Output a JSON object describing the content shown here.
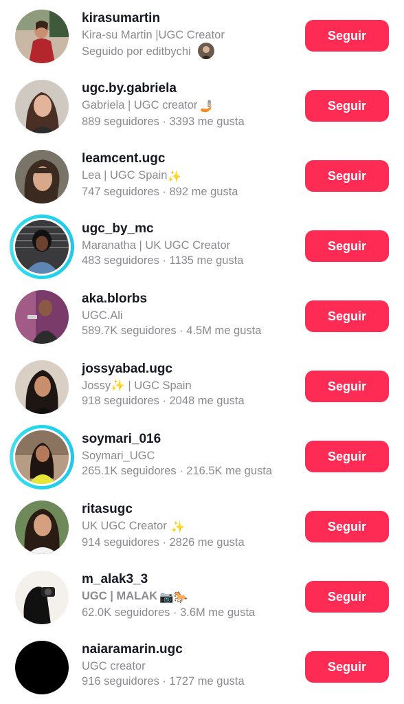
{
  "follow_label": "Seguir",
  "accent_color": "#fe2c55",
  "story_ring_color": "#20d5ec",
  "users": [
    {
      "username": "kirasumartin",
      "display": "Kira-su Martin |UGC Creator",
      "stats": "Seguido por editbychi",
      "emoji": ""
    },
    {
      "username": "ugc.by.gabriela",
      "display": "Gabriela | UGC creator",
      "stats": "889 seguidores · 3393 me gusta",
      "emoji": "🤳🏼"
    },
    {
      "username": "leamcent.ugc",
      "display": "Lea | UGC Spain",
      "stats": "747 seguidores · 892 me gusta",
      "emoji": "✨"
    },
    {
      "username": "ugc_by_mc",
      "display": "Maranatha | UK UGC Creator",
      "stats": "483 seguidores · 1135 me gusta",
      "emoji": ""
    },
    {
      "username": "aka.blorbs",
      "display": "UGC.Ali",
      "stats": "589.7K seguidores · 4.5M me gusta",
      "emoji": ""
    },
    {
      "username": "jossyabad.ugc",
      "display_pre": "Jossy",
      "display_emoji": "✨",
      "display_post": "| UGC Spain",
      "stats": "918 seguidores · 2048 me gusta"
    },
    {
      "username": "soymari_016",
      "display": "Soymari_UGC",
      "stats": "265.1K seguidores · 216.5K me gusta",
      "emoji": ""
    },
    {
      "username": "ritasugc",
      "display": "UK UGC Creator",
      "stats": "914 seguidores · 2826 me gusta",
      "emoji": "✨"
    },
    {
      "username": "m_alak3_3",
      "display": "UGC | MALAK",
      "stats": "62.0K seguidores · 3.6M me gusta",
      "emoji": "📷🐎"
    },
    {
      "username": "naiaramarin.ugc",
      "display": "UGC creator",
      "stats": "916 seguidores · 1727 me gusta",
      "emoji": ""
    }
  ]
}
